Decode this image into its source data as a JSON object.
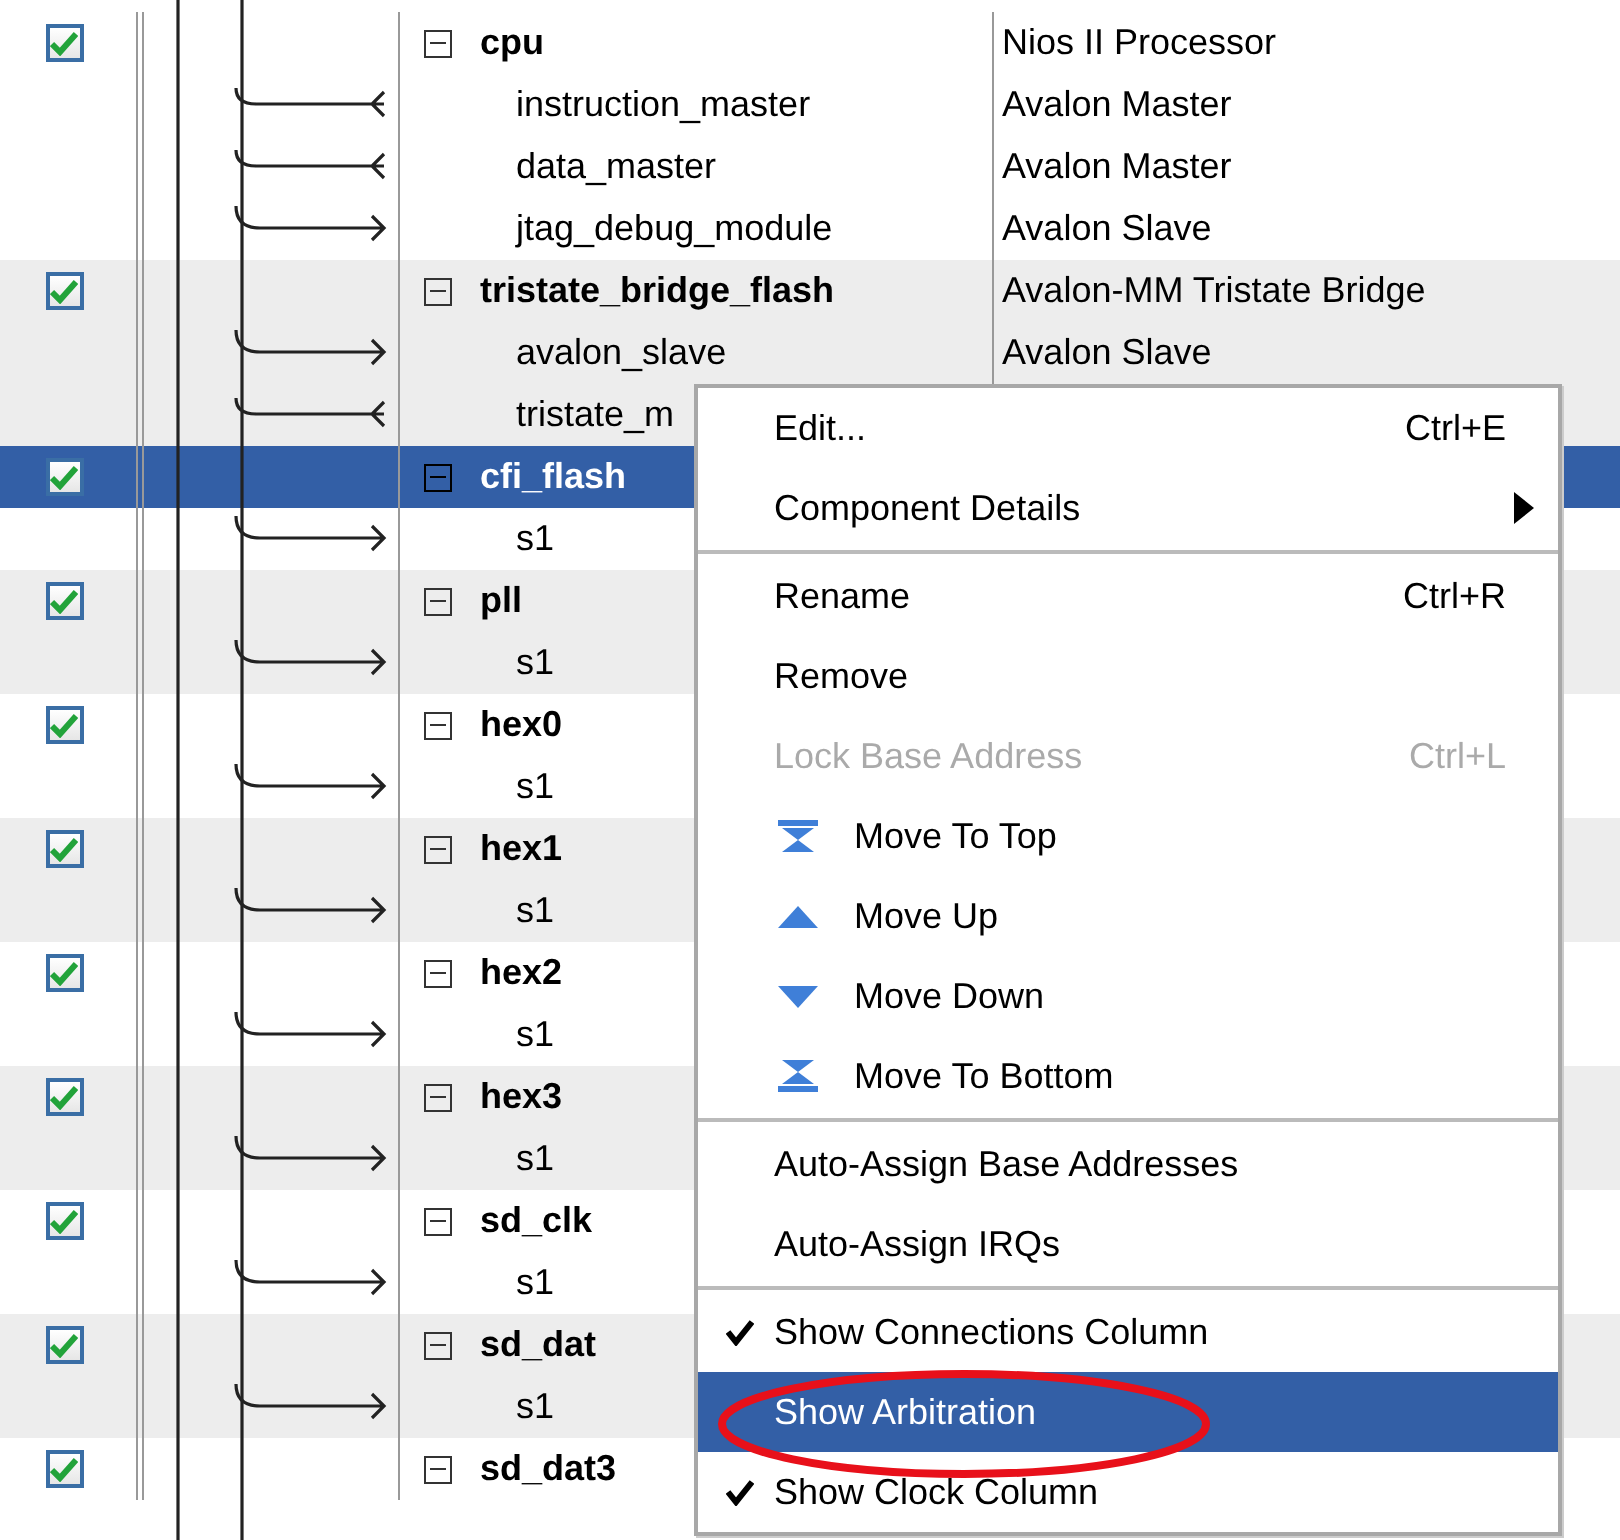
{
  "components": [
    {
      "name": "cpu",
      "description": "Nios II Processor",
      "enabled": true,
      "selected": false,
      "ports": [
        {
          "name": "instruction_master",
          "description": "Avalon Master",
          "kind": "master"
        },
        {
          "name": "data_master",
          "description": "Avalon Master",
          "kind": "master"
        },
        {
          "name": "jtag_debug_module",
          "description": "Avalon Slave",
          "kind": "slave"
        }
      ]
    },
    {
      "name": "tristate_bridge_flash",
      "description": "Avalon-MM Tristate Bridge",
      "enabled": true,
      "selected": false,
      "ports": [
        {
          "name": "avalon_slave",
          "description": "Avalon Slave",
          "kind": "slave"
        },
        {
          "name": "tristate_m",
          "kind": "master"
        }
      ]
    },
    {
      "name": "cfi_flash",
      "enabled": true,
      "selected": true,
      "ports": [
        {
          "name": "s1",
          "kind": "slave"
        }
      ]
    },
    {
      "name": "pll",
      "enabled": true,
      "selected": false,
      "ports": [
        {
          "name": "s1",
          "kind": "slave"
        }
      ]
    },
    {
      "name": "hex0",
      "enabled": true,
      "selected": false,
      "ports": [
        {
          "name": "s1",
          "kind": "slave"
        }
      ]
    },
    {
      "name": "hex1",
      "enabled": true,
      "selected": false,
      "ports": [
        {
          "name": "s1",
          "kind": "slave"
        }
      ]
    },
    {
      "name": "hex2",
      "enabled": true,
      "selected": false,
      "ports": [
        {
          "name": "s1",
          "kind": "slave"
        }
      ]
    },
    {
      "name": "hex3",
      "enabled": true,
      "selected": false,
      "ports": [
        {
          "name": "s1",
          "kind": "slave"
        }
      ]
    },
    {
      "name": "sd_clk",
      "enabled": true,
      "selected": false,
      "ports": [
        {
          "name": "s1",
          "kind": "slave"
        }
      ]
    },
    {
      "name": "sd_dat",
      "enabled": true,
      "selected": false,
      "ports": [
        {
          "name": "s1",
          "kind": "slave"
        }
      ]
    },
    {
      "name": "sd_dat3",
      "enabled": true,
      "selected": false
    }
  ],
  "context_menu": {
    "items": [
      {
        "kind": "item",
        "label": "Edit...",
        "shortcut": "Ctrl+E",
        "disabled": false,
        "checked": false,
        "selected": false,
        "submenu": false
      },
      {
        "kind": "item",
        "label": "Component Details",
        "disabled": false,
        "checked": false,
        "selected": false,
        "submenu": true
      },
      {
        "kind": "separator"
      },
      {
        "kind": "item",
        "label": "Rename",
        "shortcut": "Ctrl+R",
        "disabled": false,
        "checked": false,
        "selected": false,
        "submenu": false
      },
      {
        "kind": "item",
        "label": "Remove",
        "disabled": false,
        "checked": false,
        "selected": false,
        "submenu": false
      },
      {
        "kind": "item",
        "label": "Lock Base Address",
        "shortcut": "Ctrl+L",
        "disabled": true,
        "checked": false,
        "selected": false,
        "submenu": false
      },
      {
        "kind": "movetop",
        "label": "Move To Top",
        "disabled": false,
        "checked": false,
        "selected": false,
        "submenu": false
      },
      {
        "kind": "moveup",
        "label": "Move Up",
        "disabled": false,
        "checked": false,
        "selected": false,
        "submenu": false
      },
      {
        "kind": "movedown",
        "label": "Move Down",
        "disabled": false,
        "checked": false,
        "selected": false,
        "submenu": false
      },
      {
        "kind": "movebottom",
        "label": "Move To Bottom",
        "disabled": false,
        "checked": false,
        "selected": false,
        "submenu": false
      },
      {
        "kind": "separator"
      },
      {
        "kind": "item",
        "label": "Auto-Assign Base Addresses",
        "disabled": false,
        "checked": false,
        "selected": false,
        "submenu": false
      },
      {
        "kind": "item",
        "label": "Auto-Assign IRQs",
        "disabled": false,
        "checked": false,
        "selected": false,
        "submenu": false
      },
      {
        "kind": "separator"
      },
      {
        "kind": "item",
        "label": "Show Connections Column",
        "disabled": false,
        "checked": true,
        "selected": false,
        "submenu": false
      },
      {
        "kind": "item",
        "label": "Show Arbitration",
        "disabled": false,
        "checked": false,
        "selected": true,
        "submenu": false
      },
      {
        "kind": "item",
        "label": "Show Clock Column",
        "disabled": false,
        "checked": true,
        "selected": false,
        "submenu": false
      }
    ]
  }
}
